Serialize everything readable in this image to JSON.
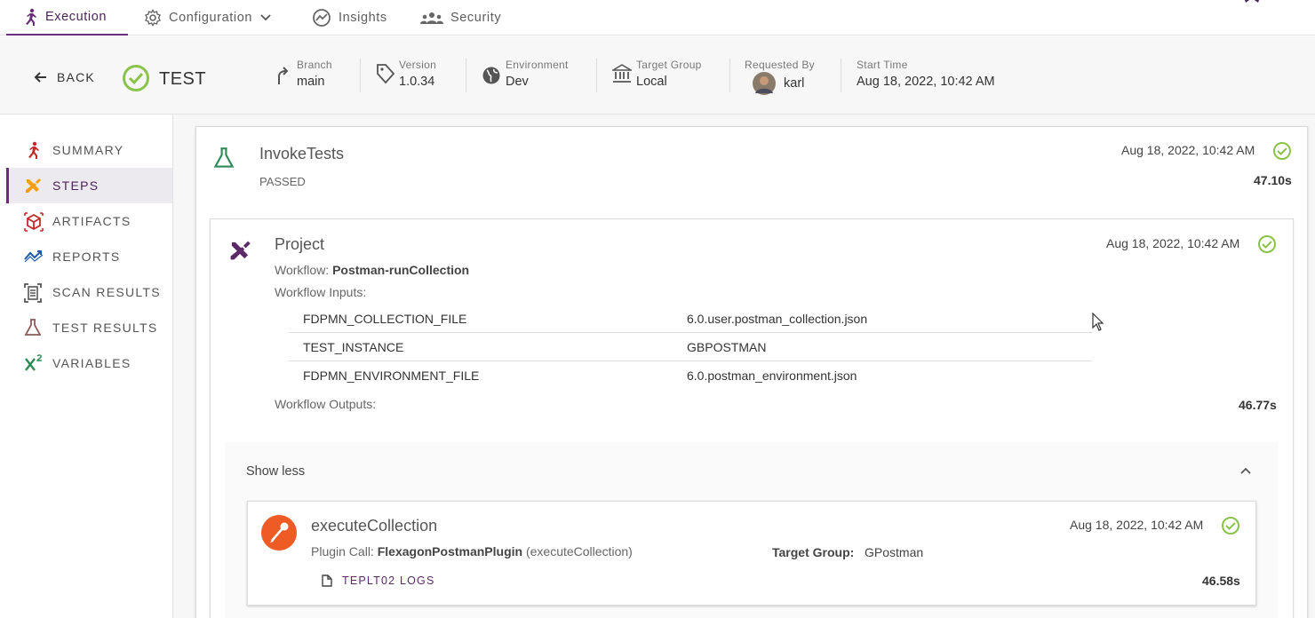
{
  "tabs": [
    {
      "label": "Execution",
      "icon": "runner-icon",
      "active": true
    },
    {
      "label": "Configuration",
      "icon": "gear-icon",
      "has_dropdown": true
    },
    {
      "label": "Insights",
      "icon": "insights-icon"
    },
    {
      "label": "Security",
      "icon": "group-icon"
    }
  ],
  "header": {
    "back_label": "BACK",
    "status_title": "TEST",
    "branch": {
      "label": "Branch",
      "value": "main"
    },
    "version": {
      "label": "Version",
      "value": "1.0.34"
    },
    "environment": {
      "label": "Environment",
      "value": "Dev"
    },
    "target_group": {
      "label": "Target Group",
      "value": "Local"
    },
    "requested_by": {
      "label": "Requested By",
      "value": "karl"
    },
    "start_time": {
      "label": "Start Time",
      "value": "Aug 18, 2022, 10:42 AM"
    }
  },
  "sidebar": {
    "items": [
      {
        "label": "SUMMARY",
        "icon": "runner-icon"
      },
      {
        "label": "STEPS",
        "icon": "tools-icon",
        "active": true
      },
      {
        "label": "ARTIFACTS",
        "icon": "package-icon"
      },
      {
        "label": "REPORTS",
        "icon": "trend-icon"
      },
      {
        "label": "SCAN RESULTS",
        "icon": "scan-icon"
      },
      {
        "label": "TEST RESULTS",
        "icon": "flask-icon"
      },
      {
        "label": "VARIABLES",
        "icon": "variable-icon"
      }
    ]
  },
  "step": {
    "name": "InvokeTests",
    "status": "PASSED",
    "date": "Aug 18, 2022, 10:42 AM",
    "duration": "47.10s",
    "project": {
      "name": "Project",
      "workflow_label": "Workflow:",
      "workflow_name": "Postman-runCollection",
      "inputs_label": "Workflow Inputs:",
      "inputs": [
        {
          "key": "FDPMN_COLLECTION_FILE",
          "value": "6.0.user.postman_collection.json"
        },
        {
          "key": "TEST_INSTANCE",
          "value": "GBPOSTMAN"
        },
        {
          "key": "FDPMN_ENVIRONMENT_FILE",
          "value": "6.0.postman_environment.json"
        }
      ],
      "outputs_label": "Workflow Outputs:",
      "date": "Aug 18, 2022, 10:42 AM",
      "duration": "46.77s",
      "show_less_label": "Show less",
      "execute": {
        "name": "executeCollection",
        "plugin_label": "Plugin Call:",
        "plugin_name": "FlexagonPostmanPlugin",
        "plugin_method": "(executeCollection)",
        "target_group_label": "Target Group:",
        "target_group_value": "GPostman",
        "logs_label": "TEPLT02 LOGS",
        "date": "Aug 18, 2022, 10:42 AM",
        "duration": "46.58s"
      }
    }
  },
  "colors": {
    "accent": "#6a2c7a",
    "success": "#8bc34a",
    "postman": "#ef5b25"
  }
}
